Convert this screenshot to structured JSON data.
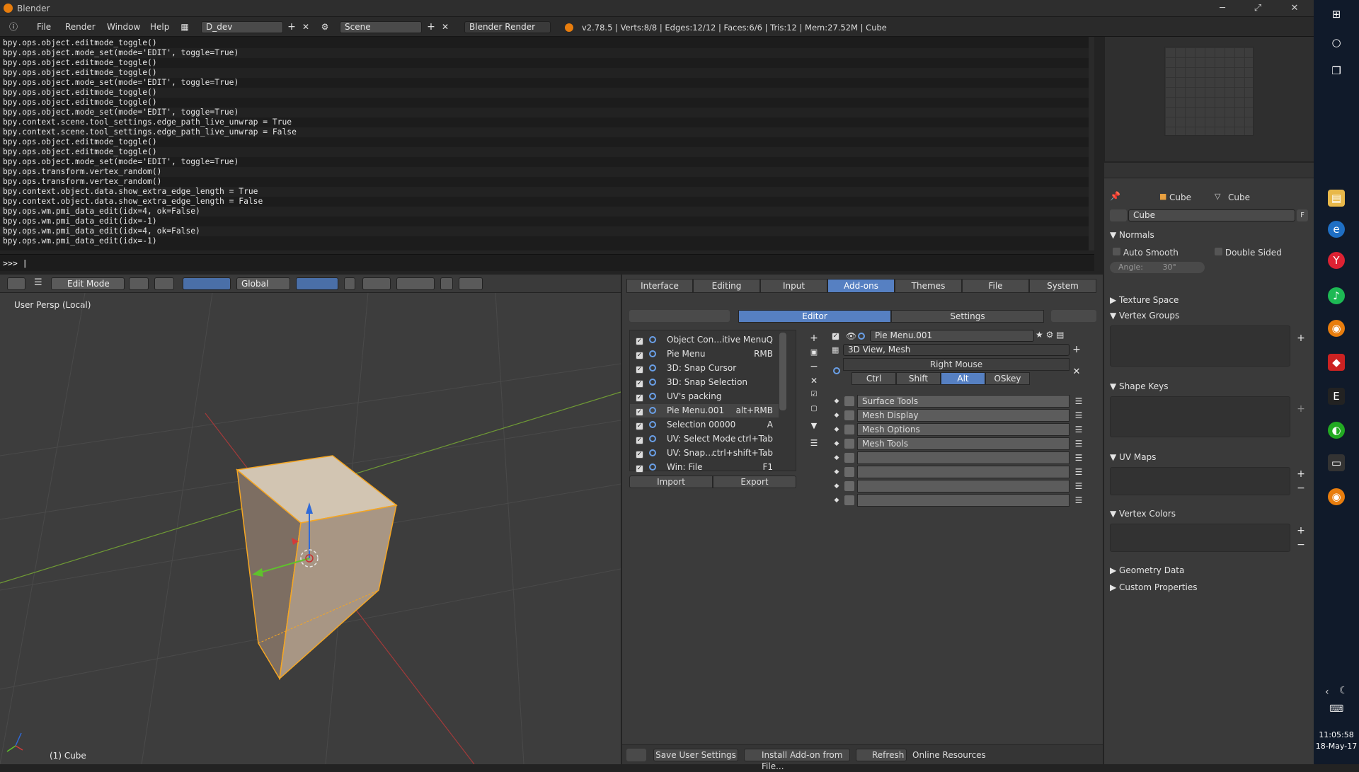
{
  "window": {
    "title": "Blender",
    "minimize": "─",
    "maximize": "⤢",
    "close": "✕"
  },
  "infobar": {
    "menus": [
      "File",
      "Render",
      "Window",
      "Help"
    ],
    "layout_name": "D_dev",
    "scene_name": "Scene",
    "renderer": "Blender Render",
    "stats": "v2.78.5 | Verts:8/8 | Edges:12/12 | Faces:6/6 | Tris:12 | Mem:27.52M | Cube"
  },
  "console": {
    "lines": [
      "bpy.ops.object.editmode_toggle()",
      "bpy.ops.object.mode_set(mode='EDIT', toggle=True)",
      "bpy.ops.object.editmode_toggle()",
      "bpy.ops.object.editmode_toggle()",
      "bpy.ops.object.mode_set(mode='EDIT', toggle=True)",
      "bpy.ops.object.editmode_toggle()",
      "bpy.ops.object.editmode_toggle()",
      "bpy.ops.object.mode_set(mode='EDIT', toggle=True)",
      "bpy.context.scene.tool_settings.edge_path_live_unwrap = True",
      "bpy.context.scene.tool_settings.edge_path_live_unwrap = False",
      "bpy.ops.object.editmode_toggle()",
      "bpy.ops.object.editmode_toggle()",
      "bpy.ops.object.mode_set(mode='EDIT', toggle=True)",
      "bpy.ops.transform.vertex_random()",
      "bpy.ops.transform.vertex_random()",
      "bpy.context.object.data.show_extra_edge_length = True",
      "bpy.context.object.data.show_extra_edge_length = False",
      "bpy.ops.wm.pmi_data_edit(idx=4, ok=False)",
      "bpy.ops.wm.pmi_data_edit(idx=-1)",
      "bpy.ops.wm.pmi_data_edit(idx=4, ok=False)",
      "bpy.ops.wm.pmi_data_edit(idx=-1)"
    ],
    "prompt": ">>> |"
  },
  "view3d": {
    "mode": "Edit Mode",
    "orientation": "Global",
    "viewport_label": "User Persp (Local)",
    "object_label": "(1) Cube"
  },
  "prefs": {
    "tabs": [
      "Interface",
      "Editing",
      "Input",
      "Add-ons",
      "Themes",
      "File",
      "System"
    ],
    "active_tab": "Add-ons",
    "subtabs": [
      "Editor",
      "Settings"
    ],
    "menu_list": [
      {
        "name": "Object Con…itive Menu",
        "key": "Q"
      },
      {
        "name": "Pie Menu",
        "key": "RMB"
      },
      {
        "name": "3D: Snap Cursor",
        "key": ""
      },
      {
        "name": "3D: Snap Selection",
        "key": ""
      },
      {
        "name": "UV's packing",
        "key": ""
      },
      {
        "name": "Pie Menu.001",
        "key": "alt+RMB"
      },
      {
        "name": "Selection 00000",
        "key": "A"
      },
      {
        "name": "UV: Select Mode",
        "key": "ctrl+Tab"
      },
      {
        "name": "UV: Snap…",
        "key": "ctrl+shift+Tab"
      },
      {
        "name": "Win: File",
        "key": "F1"
      }
    ],
    "import_label": "Import",
    "export_label": "Export",
    "selected_menu": "Pie Menu.001",
    "keymap": "3D View, Mesh",
    "hotkey": "Right Mouse",
    "modifiers": [
      "Ctrl",
      "Shift",
      "Alt",
      "OSkey"
    ],
    "active_modifier": "Alt",
    "items": [
      "Surface Tools",
      "Mesh Display",
      "Mesh Options",
      "Mesh Tools",
      "",
      "",
      "",
      ""
    ],
    "footer": {
      "save": "Save User Settings",
      "install": "Install Add-on from File...",
      "refresh": "Refresh",
      "online": "Online Resources"
    }
  },
  "properties": {
    "object_name": "Cube",
    "mesh_name": "Cube",
    "datablock": "Cube",
    "fake_user": "F",
    "panels": {
      "normals": "Normals",
      "auto_smooth": "Auto Smooth",
      "double_sided": "Double Sided",
      "angle": "Angle:",
      "angle_value": "30°",
      "texture_space": "Texture Space",
      "vertex_groups": "Vertex Groups",
      "shape_keys": "Shape Keys",
      "uv_maps": "UV Maps",
      "vertex_colors": "Vertex Colors",
      "geometry_data": "Geometry Data",
      "custom_properties": "Custom Properties"
    }
  },
  "taskbar": {
    "time": "11:05:58",
    "date": "18-May-17"
  },
  "colors": {
    "accent": "#5680c2",
    "orange": "#e87d0d",
    "selection": "#f5a623"
  }
}
